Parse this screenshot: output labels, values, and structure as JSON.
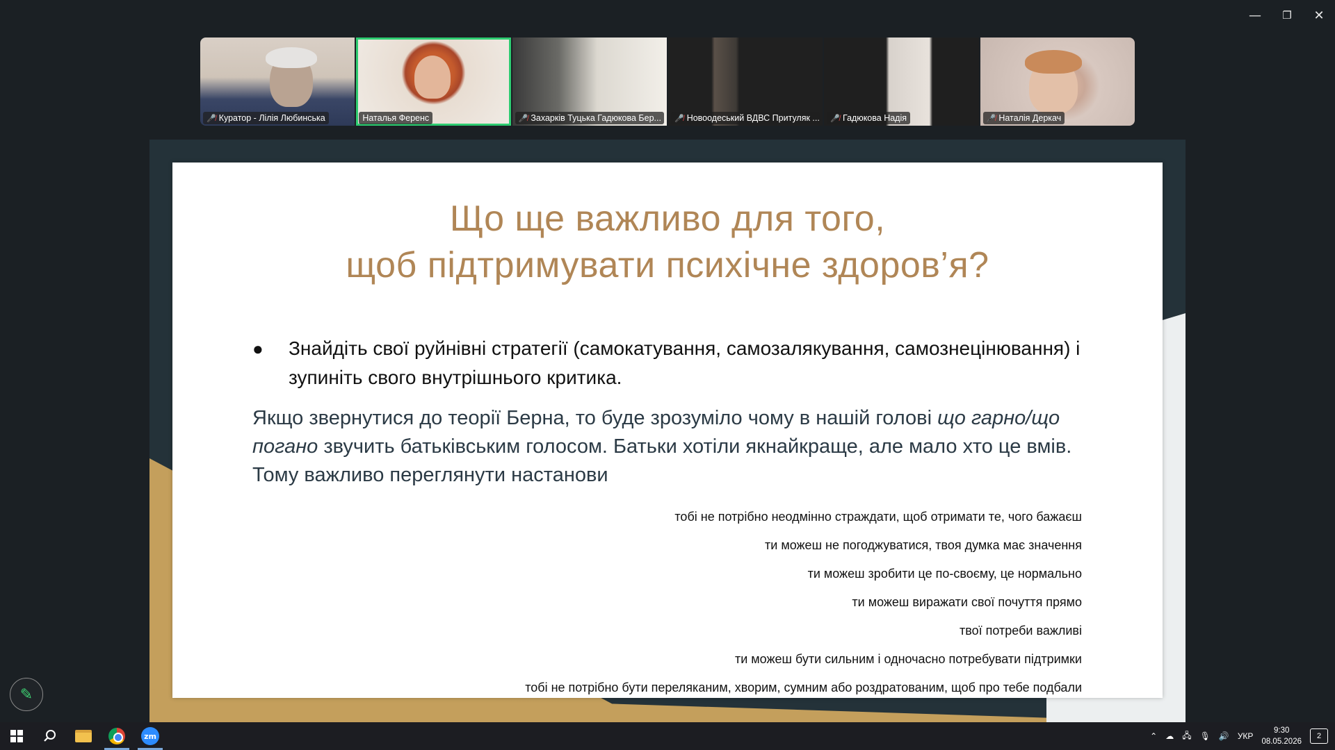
{
  "window_controls": {
    "minimize": "—",
    "restore": "❐",
    "close": "✕"
  },
  "participants": [
    {
      "name": "Куратор - Лілія Любинська",
      "muted": true,
      "active": false
    },
    {
      "name": "Наталья Ференс",
      "muted": false,
      "active": true
    },
    {
      "name": "Захарків Туцька Гадюкова Бер...",
      "muted": true,
      "active": false
    },
    {
      "name": "Новоодеський ВДВС Притуляк ...",
      "muted": true,
      "active": false
    },
    {
      "name": "Гадюкова Надія",
      "muted": true,
      "active": false
    },
    {
      "name": "Наталія Деркач",
      "muted": true,
      "active": false
    }
  ],
  "slide": {
    "title_line1": "Що ще важливо для того,",
    "title_line2": "щоб підтримувати психічне здоров’я?",
    "bullet": "Знайдіть свої руйнівні стратегії (самокатування, самозалякування, самознецінювання) і зупиніть свого внутрішнього критика.",
    "para_start": "Якщо звернутися до теорії Берна, то буде зрозуміло чому в нашій голові ",
    "para_italic": "що гарно/що погано",
    "para_end": " звучить батьківським голосом. Батьки хотіли якнайкраще, але мало хто це вмів. Тому важливо переглянути настанови",
    "affirmations": [
      "тобі не потрібно неодмінно страждати, щоб отримати те, чого бажаєш",
      "ти можеш не погоджуватися, твоя думка має значення",
      "ти можеш зробити це по-своєму, це нормально",
      "ти можеш виражати свої почуття прямо",
      "твої потреби важливі",
      "ти можеш бути сильним і одночасно потребувати підтримки",
      "тобі не потрібно бути переляканим, хворим, сумним або роздратованим, щоб про тебе подбали"
    ]
  },
  "taskbar": {
    "zoom_label": "zm",
    "lang": "УКР",
    "time": "9:30",
    "date": "08.05.2026",
    "notifications": "2"
  },
  "colors": {
    "title": "#b08656",
    "frame": "#243239",
    "gold": "#c49f5c",
    "active_border": "#2ecc71"
  }
}
